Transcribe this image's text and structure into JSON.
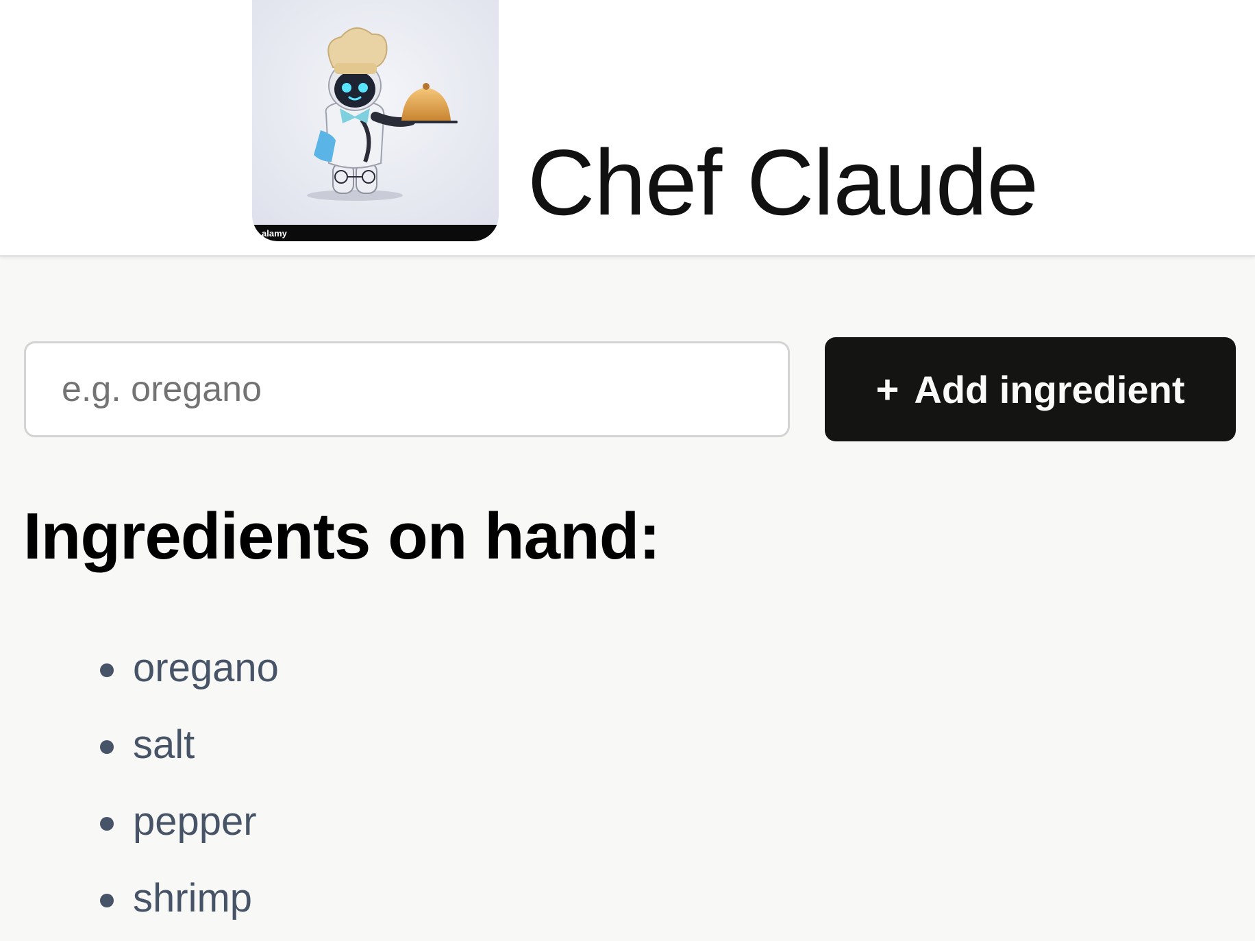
{
  "header": {
    "title": "Chef Claude",
    "logo_icon": "robot-chef-icon",
    "logo_watermark": "alamy"
  },
  "form": {
    "input_placeholder": "e.g. oregano",
    "input_value": "",
    "add_button_icon": "+",
    "add_button_label": "Add ingredient"
  },
  "ingredients": {
    "heading": "Ingredients on hand:",
    "items": [
      "oregano",
      "salt",
      "pepper",
      "shrimp"
    ]
  },
  "colors": {
    "page_background": "#f8f8f6",
    "header_background": "#ffffff",
    "button_background": "#141413",
    "button_text": "#fafaf8",
    "list_text": "#475467"
  }
}
